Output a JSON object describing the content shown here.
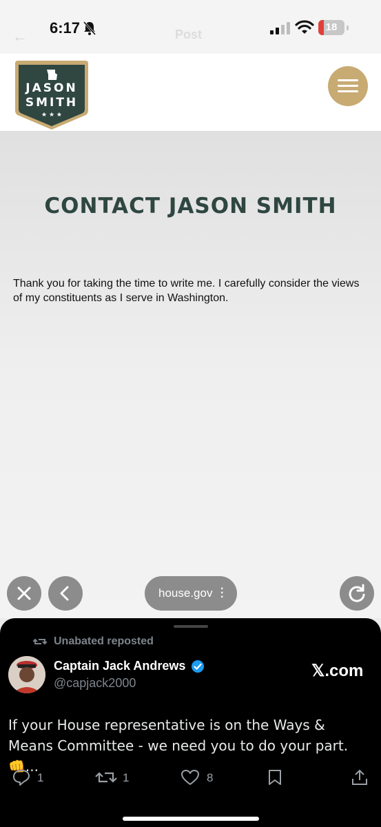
{
  "status_bar": {
    "time": "6:17",
    "battery": "18",
    "ghost_title": "Post"
  },
  "site": {
    "logo_line1": "JASON",
    "logo_line2": "SMITH",
    "brand_colors": {
      "green": "#2f4641",
      "gold": "#c8aa73"
    },
    "page_title": "CONTACT JASON SMITH",
    "body_text": "Thank you for taking the time to write me. I carefully consider the views of my constituents as I serve in Washington."
  },
  "browser": {
    "url": "house.gov",
    "buttons": [
      "close-icon",
      "back-icon",
      "more-icon",
      "reload-icon"
    ]
  },
  "tweet": {
    "repost_label": "Unabated reposted",
    "author_name": "Captain Jack Andrews",
    "handle": "@capjack2000",
    "source": "𝕏.com",
    "text": "If your House representative is on the Ways & Means Committee - we need you to do your part. 👊...",
    "replies": "1",
    "reposts": "1",
    "likes": "8"
  }
}
